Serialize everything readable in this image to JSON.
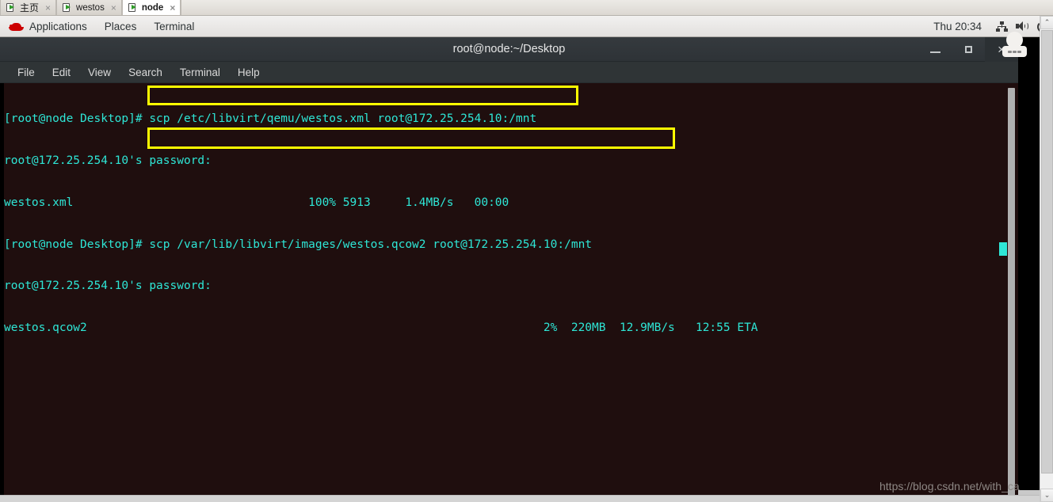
{
  "browser_tabs": {
    "tabs": [
      {
        "label": "主页",
        "icon": "document-play-icon",
        "close": "×",
        "active": false
      },
      {
        "label": "westos",
        "icon": "document-play-icon",
        "close": "×",
        "active": false
      },
      {
        "label": "node",
        "icon": "document-play-icon",
        "close": "×",
        "active": true
      }
    ]
  },
  "gnome_panel": {
    "logo_icon": "redhat-logo-icon",
    "menus": [
      {
        "label": "Applications"
      },
      {
        "label": "Places"
      },
      {
        "label": "Terminal"
      }
    ],
    "clock": "Thu 20:34",
    "tray": [
      {
        "icon": "network-icon"
      },
      {
        "icon": "volume-icon"
      },
      {
        "icon": "power-icon"
      }
    ]
  },
  "terminal_window": {
    "title": "root@node:~/Desktop",
    "window_controls": {
      "minimize": "minimize-icon",
      "maximize": "maximize-icon",
      "close": "×"
    },
    "menubar": [
      {
        "label": "File"
      },
      {
        "label": "Edit"
      },
      {
        "label": "View"
      },
      {
        "label": "Search"
      },
      {
        "label": "Terminal"
      },
      {
        "label": "Help"
      }
    ],
    "lines": [
      "[root@node Desktop]# scp /etc/libvirt/qemu/westos.xml root@172.25.254.10:/mnt",
      "root@172.25.254.10's password:",
      "westos.xml                                  100% 5913     1.4MB/s   00:00",
      "[root@node Desktop]# scp /var/lib/libvirt/images/westos.qcow2 root@172.25.254.10:/mnt",
      "root@172.25.254.10's password:",
      "westos.qcow2                                                                  2%  220MB  12.9MB/s   12:55 ETA"
    ],
    "commands_highlighted": [
      "scp /etc/libvirt/qemu/westos.xml root@172.25.254.10:/mnt",
      "scp /var/lib/libvirt/images/westos.qcow2 root@172.25.254.10:/mnt"
    ],
    "transfers": [
      {
        "file": "westos.xml",
        "percent": "100%",
        "size": "5913",
        "rate": "1.4MB/s",
        "eta": "00:00"
      },
      {
        "file": "westos.qcow2",
        "percent": "2%",
        "size": "220MB",
        "rate": "12.9MB/s",
        "eta": "12:55 ETA"
      }
    ]
  },
  "annotations": {
    "highlight_color": "#ffff00",
    "boxes": [
      {
        "target": "scp-xml-command"
      },
      {
        "target": "scp-qcow2-command"
      }
    ]
  },
  "watermark": {
    "text": "https://blog.csdn.net/with_ca"
  },
  "scrollbars": {
    "outer_up_arrow": "⌃",
    "outer_down_arrow": "⌄"
  },
  "colors": {
    "terminal_bg": "#1f0e0e",
    "terminal_fg": "#2ee6d6",
    "highlight": "#ffff00",
    "titlebar_bg": "#2e3337"
  }
}
